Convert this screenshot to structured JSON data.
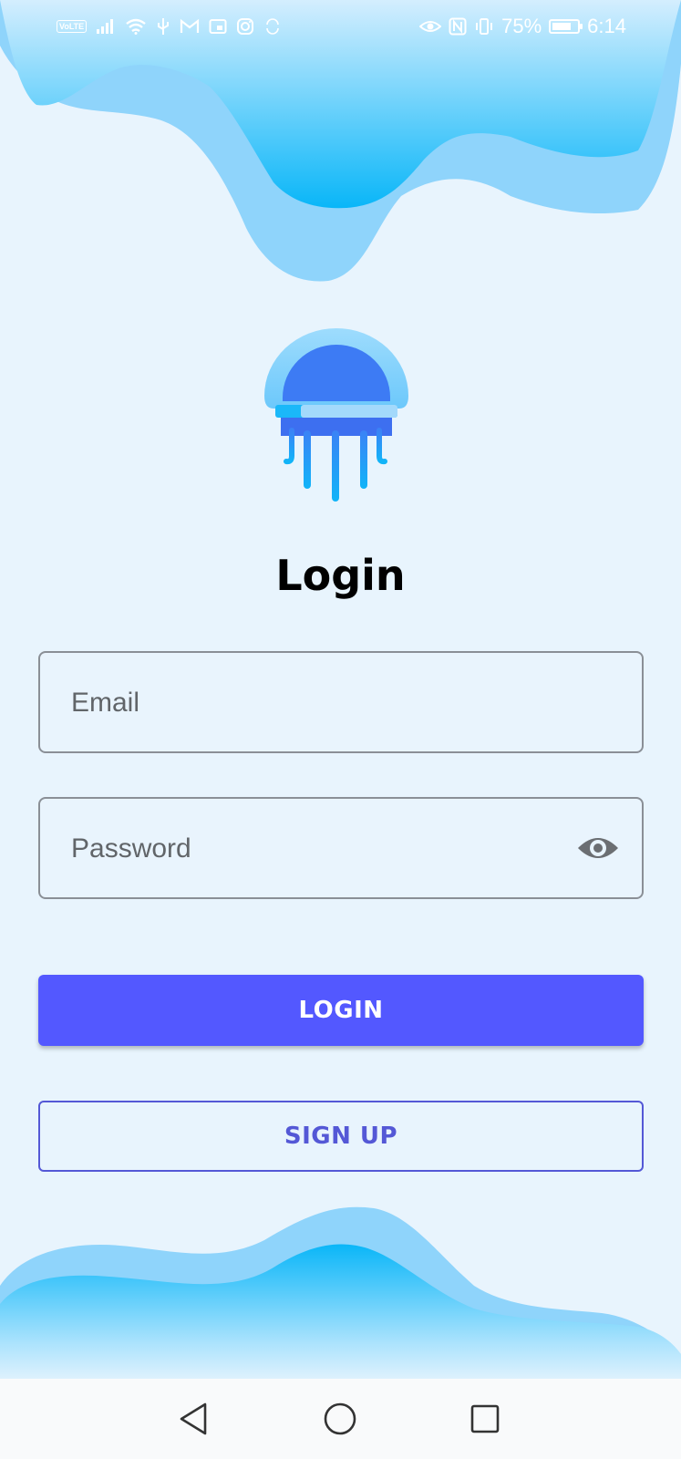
{
  "status_bar": {
    "volte": "VoLTE",
    "battery_percent": "75%",
    "battery_level": 0.75,
    "time": "6:14",
    "icons": [
      "signal-icon",
      "wifi-icon",
      "usb-icon",
      "gmail-icon",
      "calendar-icon",
      "instagram-icon",
      "sync-icon",
      "eye-comfort-icon",
      "nfc-icon",
      "vibrate-icon",
      "battery-icon"
    ]
  },
  "login_form": {
    "title": "Login",
    "email_placeholder": "Email",
    "email_value": "",
    "password_placeholder": "Password",
    "password_value": "",
    "login_label": "LOGIN",
    "signup_label": "SIGN UP"
  },
  "colors": {
    "background": "#e8f4fd",
    "primary": "#5358ff",
    "secondary_outline": "#5458d6",
    "wave_light": "#8fd4fb",
    "wave_dark": "#12b5f8"
  },
  "nav_bar": {
    "icons": [
      "back-icon",
      "home-icon",
      "recents-icon"
    ]
  }
}
